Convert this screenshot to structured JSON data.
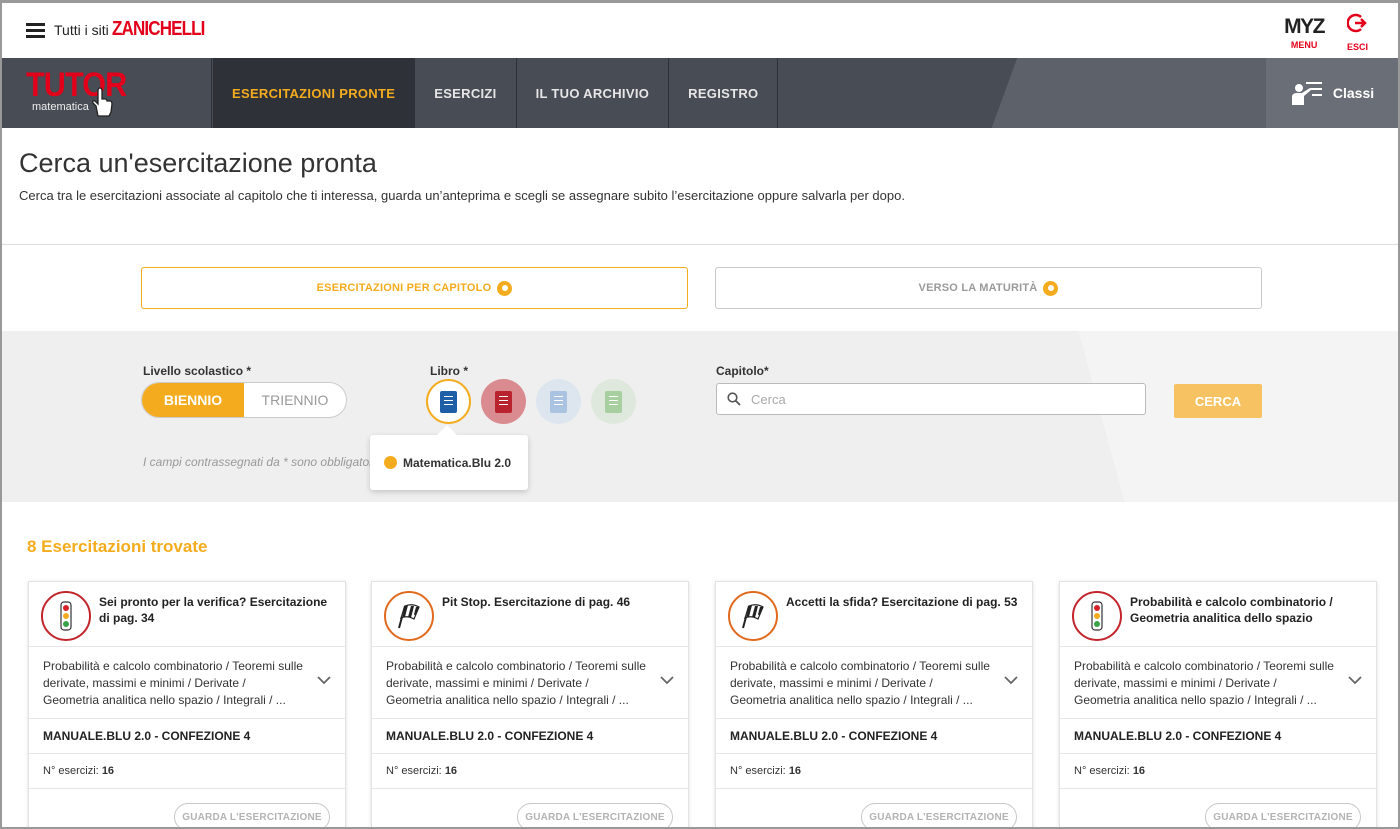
{
  "topbar": {
    "all_sites": "Tutti i siti",
    "brand": "ZANICHELLI",
    "myz_logo": "MYZ",
    "myz_label": "MENU",
    "logout_label": "ESCI"
  },
  "nav": {
    "logo_title": "TUTOR",
    "logo_subtitle": "matematica",
    "items": [
      {
        "label": "ESERCITAZIONI PRONTE",
        "active": true
      },
      {
        "label": "ESERCIZI",
        "active": false
      },
      {
        "label": "IL TUO ARCHIVIO",
        "active": false
      },
      {
        "label": "REGISTRO",
        "active": false
      }
    ],
    "classes_label": "Classi"
  },
  "header": {
    "title": "Cerca un'esercitazione pronta",
    "subtitle": "Cerca tra le esercitazioni associate al capitolo che ti interessa, guarda un’anteprima e scegli se assegnare subito l’esercitazione oppure salvarla per dopo."
  },
  "tabs": [
    {
      "label": "ESERCITAZIONI PER CAPITOLO",
      "active": true
    },
    {
      "label": "VERSO LA MATURITÀ",
      "active": false
    }
  ],
  "filters": {
    "level_label": "Livello scolastico *",
    "level_options": [
      "BIENNIO",
      "TRIENNIO"
    ],
    "book_label": "Libro *",
    "books": [
      {
        "color": "#1e5fa8",
        "selected": true
      },
      {
        "color": "#b9232e",
        "selected": false
      },
      {
        "color": "#a9c3e0",
        "selected": false
      },
      {
        "color": "#a8cf9f",
        "selected": false
      }
    ],
    "book_tooltip": "Matematica.Blu 2.0",
    "chapter_label": "Capitolo*",
    "search_placeholder": "Cerca",
    "search_button": "CERCA",
    "required_hint": "I campi contrassegnati da * sono obbligatori"
  },
  "results": {
    "count_label": "8 Esercitazioni trovate",
    "cards": [
      {
        "icon": "traffic-light",
        "title": "Sei pronto per la verifica? Esercitazione di pag. 34",
        "description": "Probabilità e calcolo combinatorio / Teoremi sulle derivate, massimi e minimi / Derivate / Geometria analitica nello spazio / Integrali / ...",
        "book": "MANUALE.BLU 2.0 - CONFEZIONE 4",
        "count_label": "N° esercizi:",
        "count": "16",
        "button": "GUARDA L'ESERCITAZIONE"
      },
      {
        "icon": "checkered-flag",
        "title": "Pit Stop. Esercitazione di pag. 46",
        "description": "Probabilità e calcolo combinatorio / Teoremi sulle derivate, massimi e minimi / Derivate / Geometria analitica nello spazio / Integrali / ...",
        "book": "MANUALE.BLU 2.0 - CONFEZIONE 4",
        "count_label": "N° esercizi:",
        "count": "16",
        "button": "GUARDA L'ESERCITAZIONE"
      },
      {
        "icon": "checkered-flag",
        "title": "Accetti la sfida? Esercitazione di pag. 53",
        "description": "Probabilità e calcolo combinatorio / Teoremi sulle derivate, massimi e minimi / Derivate / Geometria analitica nello spazio / Integrali / ...",
        "book": "MANUALE.BLU 2.0 - CONFEZIONE 4",
        "count_label": "N° esercizi:",
        "count": "16",
        "button": "GUARDA L'ESERCITAZIONE"
      },
      {
        "icon": "traffic-light",
        "title": "Probabilità e calcolo combinatorio / Geometria analitica dello spazio",
        "description": "Probabilità e calcolo combinatorio / Teoremi sulle derivate, massimi e minimi / Derivate / Geometria analitica nello spazio / Integrali / ...",
        "book": "MANUALE.BLU 2.0 - CONFEZIONE 4",
        "count_label": "N° esercizi:",
        "count": "16",
        "button": "GUARDA L'ESERCITAZIONE"
      }
    ]
  },
  "colors": {
    "accent": "#f4ac1e",
    "brand_red": "#e2001a",
    "nav_bg": "#484c55"
  }
}
